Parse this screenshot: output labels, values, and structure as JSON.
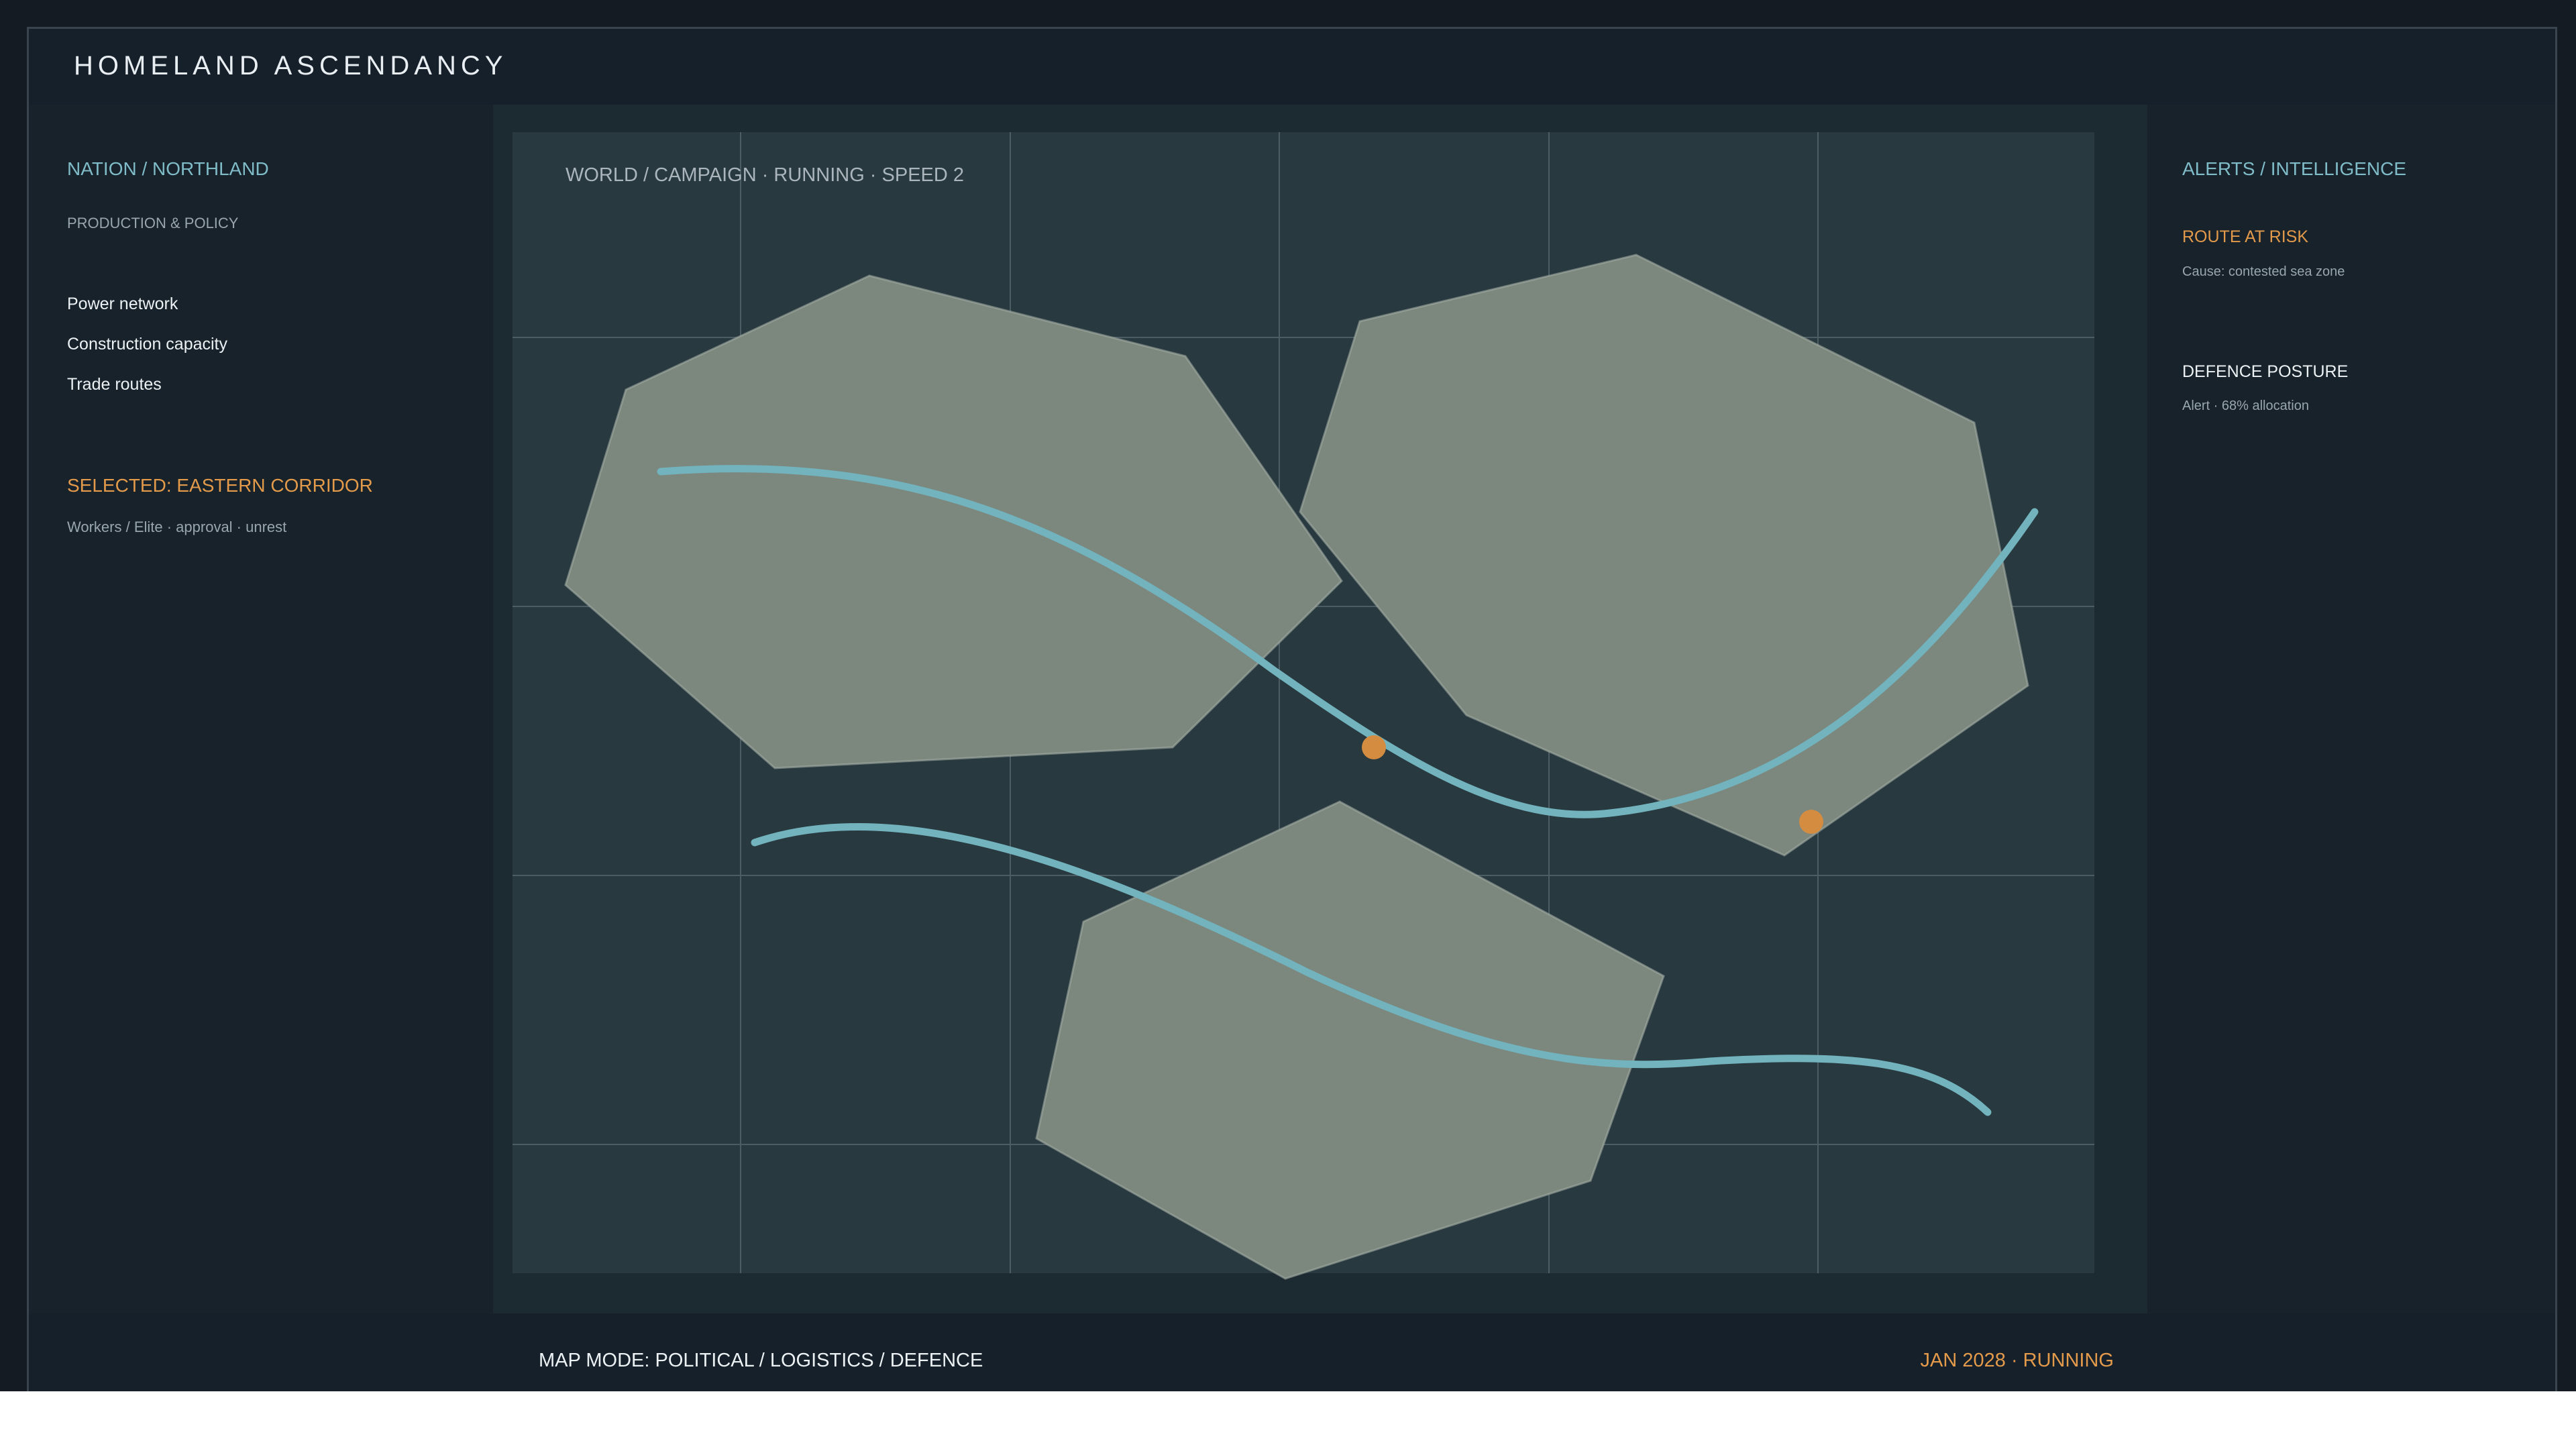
{
  "app": {
    "title": "HOMELAND ASCENDANCY"
  },
  "left_panel": {
    "nation": "NATION / NORTHLAND",
    "section": "PRODUCTION & POLICY",
    "menu": [
      {
        "label": "Power network"
      },
      {
        "label": "Construction capacity"
      },
      {
        "label": "Trade routes"
      }
    ],
    "selected_title": "SELECTED: EASTERN CORRIDOR",
    "selected_detail": "Workers / Elite · approval · unrest"
  },
  "map": {
    "header": "WORLD / CAMPAIGN · RUNNING · SPEED 2",
    "colors": {
      "background": "#28393f",
      "region_fill": "#7c877e",
      "route": "#72b3bd",
      "marker": "#d48d40",
      "grid": "#4d5d64"
    }
  },
  "right_panel": {
    "title": "ALERTS / INTELLIGENCE",
    "alerts": [
      {
        "title": "ROUTE AT RISK",
        "detail": "Cause: contested sea zone"
      },
      {
        "title": "DEFENCE POSTURE",
        "detail": "Alert · 68% allocation"
      }
    ]
  },
  "footer": {
    "map_mode": "MAP MODE: POLITICAL / LOGISTICS / DEFENCE",
    "status": "JAN 2028 · RUNNING"
  }
}
